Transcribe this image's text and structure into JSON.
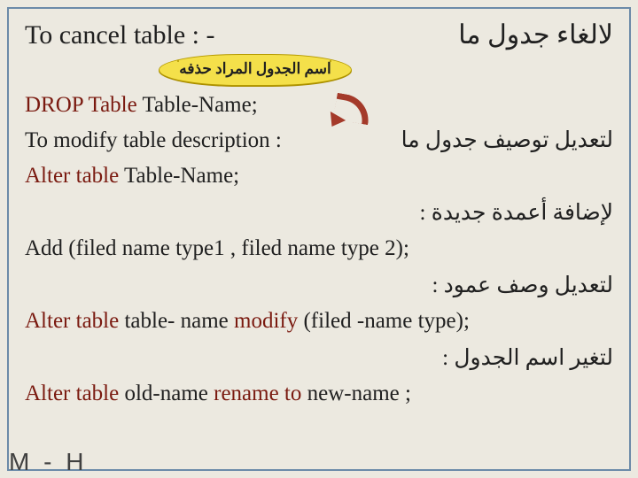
{
  "header": {
    "left": "To cancel table : -",
    "right": "لالغاء جدول ما"
  },
  "bubble": "اسم الجدول المراد حذفه",
  "lines": {
    "drop_pre": "DROP  Table  ",
    "drop_name": "Table-Name;",
    "modify_left": "To modify table description : ",
    "modify_right": "لتعديل توصيف جدول ما",
    "alter1_pre": "Alter  table ",
    "alter1_name": "Table-Name;",
    "add_cols_ar": "لإضافة أعمدة جديدة :",
    "add_stmt": "Add (filed name type1 , filed name type 2);",
    "mod_col_ar": "لتعديل وصف عمود :",
    "alter2_a": "Alter  table ",
    "alter2_b": "table- name  ",
    "alter2_c": "modify ",
    "alter2_d": "(filed -name   type);",
    "rename_ar": "لتغير اسم الجدول :",
    "alter3_a": "Alter table  ",
    "alter3_b": "old-name ",
    "alter3_c": "rename to ",
    "alter3_d": "new-name ;"
  },
  "footer": "M - H"
}
